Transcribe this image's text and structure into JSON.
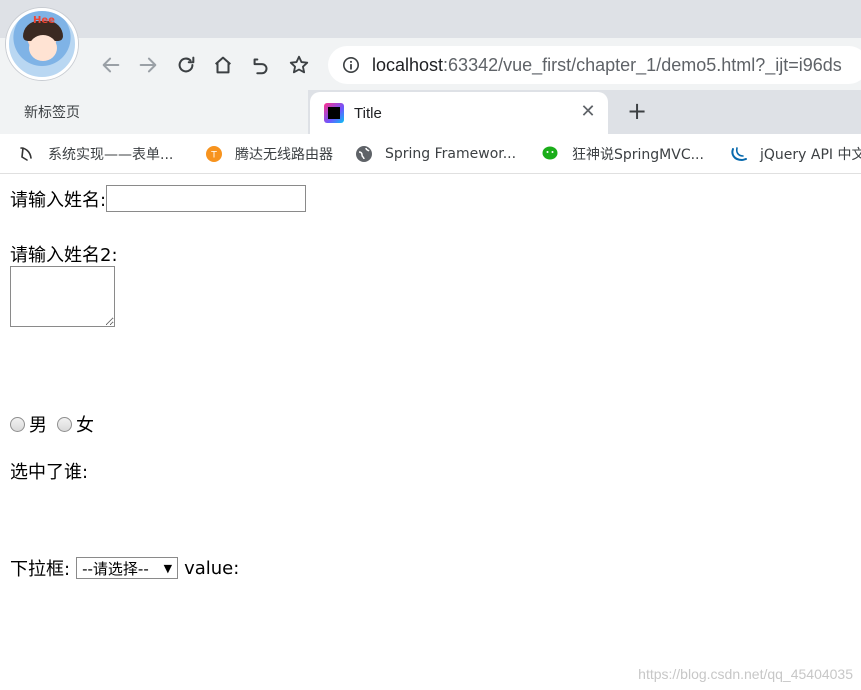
{
  "browser": {
    "url_host": "localhost",
    "url_rest": ":63342/vue_first/chapter_1/demo5.html?_ijt=i96ds",
    "avatar_tag": "Hee",
    "tabs": [
      {
        "label": "新标签页"
      },
      {
        "label": "Title"
      }
    ],
    "new_tab_symbol": "+",
    "close_symbol": "✕",
    "bookmarks": [
      {
        "label": "系统实现——表单...",
        "icon": "feather-icon"
      },
      {
        "label": "腾达无线路由器",
        "icon": "tenda-icon"
      },
      {
        "label": "Spring Framewor...",
        "icon": "globe-icon"
      },
      {
        "label": "狂神说SpringMVC...",
        "icon": "wechat-icon"
      },
      {
        "label": "jQuery API 中文",
        "icon": "jquery-icon"
      }
    ]
  },
  "form": {
    "name_label": "请输入姓名:",
    "name_value": "",
    "name2_label": "请输入姓名2:",
    "radio_male": "男",
    "radio_female": "女",
    "selected_label": "选中了谁:",
    "select_label": "下拉框:",
    "select_value": "--请选择--",
    "value_label": "value:"
  },
  "watermark": "https://blog.csdn.net/qq_45404035",
  "colors": {
    "chrome_bg": "#dee1e6",
    "toolbar_bg": "#f1f3f4",
    "text_dark": "#202124"
  }
}
